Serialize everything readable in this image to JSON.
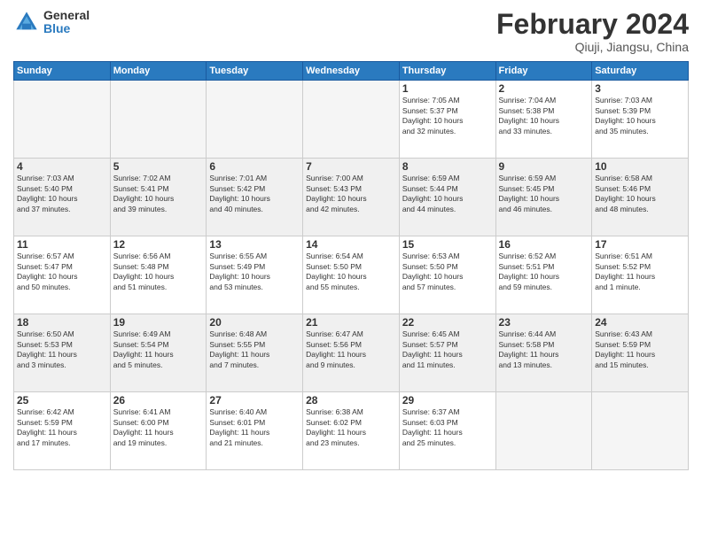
{
  "header": {
    "logo_general": "General",
    "logo_blue": "Blue",
    "month_title": "February 2024",
    "location": "Qiuji, Jiangsu, China"
  },
  "days_of_week": [
    "Sunday",
    "Monday",
    "Tuesday",
    "Wednesday",
    "Thursday",
    "Friday",
    "Saturday"
  ],
  "weeks": [
    {
      "shaded": false,
      "days": [
        {
          "num": "",
          "info": "",
          "empty": true
        },
        {
          "num": "",
          "info": "",
          "empty": true
        },
        {
          "num": "",
          "info": "",
          "empty": true
        },
        {
          "num": "",
          "info": "",
          "empty": true
        },
        {
          "num": "1",
          "info": "Sunrise: 7:05 AM\nSunset: 5:37 PM\nDaylight: 10 hours\nand 32 minutes.",
          "empty": false
        },
        {
          "num": "2",
          "info": "Sunrise: 7:04 AM\nSunset: 5:38 PM\nDaylight: 10 hours\nand 33 minutes.",
          "empty": false
        },
        {
          "num": "3",
          "info": "Sunrise: 7:03 AM\nSunset: 5:39 PM\nDaylight: 10 hours\nand 35 minutes.",
          "empty": false
        }
      ]
    },
    {
      "shaded": true,
      "days": [
        {
          "num": "4",
          "info": "Sunrise: 7:03 AM\nSunset: 5:40 PM\nDaylight: 10 hours\nand 37 minutes.",
          "empty": false
        },
        {
          "num": "5",
          "info": "Sunrise: 7:02 AM\nSunset: 5:41 PM\nDaylight: 10 hours\nand 39 minutes.",
          "empty": false
        },
        {
          "num": "6",
          "info": "Sunrise: 7:01 AM\nSunset: 5:42 PM\nDaylight: 10 hours\nand 40 minutes.",
          "empty": false
        },
        {
          "num": "7",
          "info": "Sunrise: 7:00 AM\nSunset: 5:43 PM\nDaylight: 10 hours\nand 42 minutes.",
          "empty": false
        },
        {
          "num": "8",
          "info": "Sunrise: 6:59 AM\nSunset: 5:44 PM\nDaylight: 10 hours\nand 44 minutes.",
          "empty": false
        },
        {
          "num": "9",
          "info": "Sunrise: 6:59 AM\nSunset: 5:45 PM\nDaylight: 10 hours\nand 46 minutes.",
          "empty": false
        },
        {
          "num": "10",
          "info": "Sunrise: 6:58 AM\nSunset: 5:46 PM\nDaylight: 10 hours\nand 48 minutes.",
          "empty": false
        }
      ]
    },
    {
      "shaded": false,
      "days": [
        {
          "num": "11",
          "info": "Sunrise: 6:57 AM\nSunset: 5:47 PM\nDaylight: 10 hours\nand 50 minutes.",
          "empty": false
        },
        {
          "num": "12",
          "info": "Sunrise: 6:56 AM\nSunset: 5:48 PM\nDaylight: 10 hours\nand 51 minutes.",
          "empty": false
        },
        {
          "num": "13",
          "info": "Sunrise: 6:55 AM\nSunset: 5:49 PM\nDaylight: 10 hours\nand 53 minutes.",
          "empty": false
        },
        {
          "num": "14",
          "info": "Sunrise: 6:54 AM\nSunset: 5:50 PM\nDaylight: 10 hours\nand 55 minutes.",
          "empty": false
        },
        {
          "num": "15",
          "info": "Sunrise: 6:53 AM\nSunset: 5:50 PM\nDaylight: 10 hours\nand 57 minutes.",
          "empty": false
        },
        {
          "num": "16",
          "info": "Sunrise: 6:52 AM\nSunset: 5:51 PM\nDaylight: 10 hours\nand 59 minutes.",
          "empty": false
        },
        {
          "num": "17",
          "info": "Sunrise: 6:51 AM\nSunset: 5:52 PM\nDaylight: 11 hours\nand 1 minute.",
          "empty": false
        }
      ]
    },
    {
      "shaded": true,
      "days": [
        {
          "num": "18",
          "info": "Sunrise: 6:50 AM\nSunset: 5:53 PM\nDaylight: 11 hours\nand 3 minutes.",
          "empty": false
        },
        {
          "num": "19",
          "info": "Sunrise: 6:49 AM\nSunset: 5:54 PM\nDaylight: 11 hours\nand 5 minutes.",
          "empty": false
        },
        {
          "num": "20",
          "info": "Sunrise: 6:48 AM\nSunset: 5:55 PM\nDaylight: 11 hours\nand 7 minutes.",
          "empty": false
        },
        {
          "num": "21",
          "info": "Sunrise: 6:47 AM\nSunset: 5:56 PM\nDaylight: 11 hours\nand 9 minutes.",
          "empty": false
        },
        {
          "num": "22",
          "info": "Sunrise: 6:45 AM\nSunset: 5:57 PM\nDaylight: 11 hours\nand 11 minutes.",
          "empty": false
        },
        {
          "num": "23",
          "info": "Sunrise: 6:44 AM\nSunset: 5:58 PM\nDaylight: 11 hours\nand 13 minutes.",
          "empty": false
        },
        {
          "num": "24",
          "info": "Sunrise: 6:43 AM\nSunset: 5:59 PM\nDaylight: 11 hours\nand 15 minutes.",
          "empty": false
        }
      ]
    },
    {
      "shaded": false,
      "days": [
        {
          "num": "25",
          "info": "Sunrise: 6:42 AM\nSunset: 5:59 PM\nDaylight: 11 hours\nand 17 minutes.",
          "empty": false
        },
        {
          "num": "26",
          "info": "Sunrise: 6:41 AM\nSunset: 6:00 PM\nDaylight: 11 hours\nand 19 minutes.",
          "empty": false
        },
        {
          "num": "27",
          "info": "Sunrise: 6:40 AM\nSunset: 6:01 PM\nDaylight: 11 hours\nand 21 minutes.",
          "empty": false
        },
        {
          "num": "28",
          "info": "Sunrise: 6:38 AM\nSunset: 6:02 PM\nDaylight: 11 hours\nand 23 minutes.",
          "empty": false
        },
        {
          "num": "29",
          "info": "Sunrise: 6:37 AM\nSunset: 6:03 PM\nDaylight: 11 hours\nand 25 minutes.",
          "empty": false
        },
        {
          "num": "",
          "info": "",
          "empty": true
        },
        {
          "num": "",
          "info": "",
          "empty": true
        }
      ]
    }
  ]
}
